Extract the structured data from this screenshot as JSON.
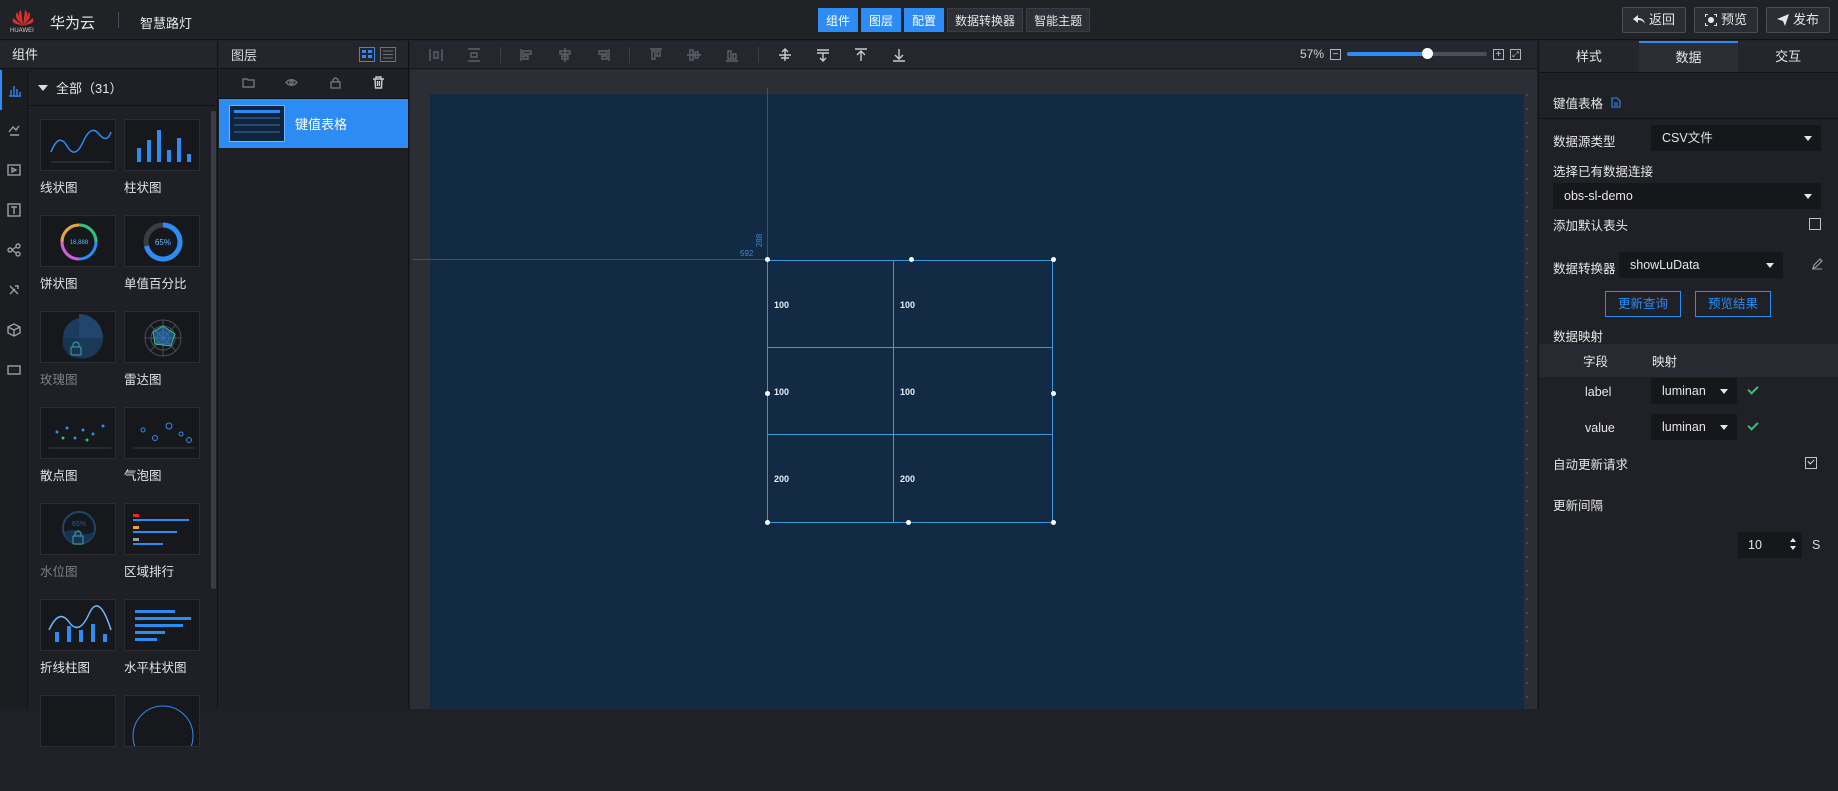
{
  "header": {
    "brand": "华为云",
    "logo_text": "HUAWEI",
    "app_name": "智慧路灯",
    "tabs": [
      {
        "label": "组件",
        "active": true
      },
      {
        "label": "图层",
        "active": true
      },
      {
        "label": "配置",
        "active": true
      },
      {
        "label": "数据转换器",
        "active": false
      },
      {
        "label": "智能主题",
        "active": false
      }
    ],
    "actions": [
      {
        "label": "返回",
        "icon": "back-icon"
      },
      {
        "label": "预览",
        "icon": "preview-icon"
      },
      {
        "label": "发布",
        "icon": "send-icon"
      }
    ]
  },
  "components_panel": {
    "title": "组件",
    "all_label": "全部（31）",
    "items": [
      {
        "label": "线状图",
        "locked": false
      },
      {
        "label": "柱状图",
        "locked": false
      },
      {
        "label": "饼状图",
        "locked": false,
        "value": "16,888"
      },
      {
        "label": "单值百分比",
        "locked": false,
        "value": "65%"
      },
      {
        "label": "玫瑰图",
        "locked": true
      },
      {
        "label": "雷达图",
        "locked": false
      },
      {
        "label": "散点图",
        "locked": false
      },
      {
        "label": "气泡图",
        "locked": false
      },
      {
        "label": "水位图",
        "locked": true,
        "value": "65%"
      },
      {
        "label": "区域排行",
        "locked": false
      },
      {
        "label": "折线柱图",
        "locked": false
      },
      {
        "label": "水平柱状图",
        "locked": false
      }
    ]
  },
  "layers_panel": {
    "title": "图层",
    "items": [
      {
        "label": "键值表格",
        "selected": true
      }
    ]
  },
  "canvas": {
    "zoom_label": "57%",
    "zoom_fraction": 0.57,
    "guide_x": "592",
    "guide_y": "288",
    "table": [
      [
        "100",
        "100"
      ],
      [
        "100",
        "100"
      ],
      [
        "200",
        "200"
      ]
    ]
  },
  "right_panel": {
    "tabs": [
      {
        "label": "样式",
        "active": false
      },
      {
        "label": "数据",
        "active": true
      },
      {
        "label": "交互",
        "active": false
      }
    ],
    "component_name": "键值表格",
    "datasource_type_label": "数据源类型",
    "datasource_type_value": "CSV文件",
    "connection_label": "选择已有数据连接",
    "connection_value": "obs-sl-demo",
    "default_header_label": "添加默认表头",
    "converter_label": "数据转换器",
    "converter_value": "showLuData",
    "update_query_btn": "更新查询",
    "preview_result_btn": "预览结果",
    "mapping_label": "数据映射",
    "mapping_col_field": "字段",
    "mapping_col_map": "映射",
    "mappings": [
      {
        "field": "label",
        "value": "luminan"
      },
      {
        "field": "value",
        "value": "luminan"
      }
    ],
    "auto_update_label": "自动更新请求",
    "interval_label": "更新间隔",
    "interval_value": "10",
    "interval_unit": "S"
  },
  "colors": {
    "accent": "#2c8cf4",
    "canvas_bg": "#132a45",
    "success": "#2ec27e"
  }
}
